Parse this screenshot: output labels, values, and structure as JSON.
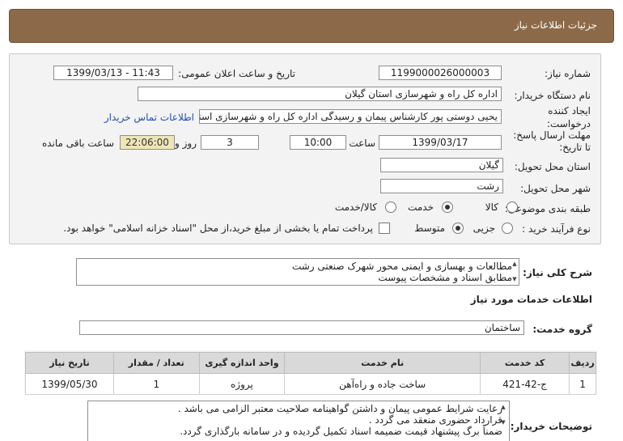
{
  "header": {
    "title": "جزئیات اطلاعات نیاز"
  },
  "form": {
    "need_number_label": "شماره نیاز:",
    "need_number": "1199000026000003",
    "announce_label": "تاریخ و ساعت اعلان عمومی:",
    "announce_value": "1399/03/13 - 11:43",
    "buyer_label": "نام دستگاه خریدار:",
    "buyer_value": "اداره کل راه و شهرسازی استان گیلان",
    "creator_label_1": "ایجاد کننده",
    "creator_label_2": "درخواست:",
    "creator_value": "یحیی دوستی پور کارشناس پیمان و رسیدگی اداره کل راه و شهرسازی استان",
    "contact_link": "اطلاعات تماس خریدار",
    "deadline_label_1": "مهلت ارسال پاسخ:",
    "deadline_label_2": "تا تاریخ:",
    "deadline_date": "1399/03/17",
    "time_label": "ساعت",
    "deadline_time": "10:00",
    "days_value": "3",
    "days_label": "روز و",
    "remaining_time": "22:06:00",
    "remaining_label": "ساعت باقی مانده",
    "province_label": "استان محل تحویل:",
    "province_value": "گیلان",
    "city_label": "شهر محل تحویل:",
    "city_value": "رشت",
    "category_label": "طبقه بندی موضوعی:",
    "category_options": [
      "کالا",
      "خدمت",
      "کالا/خدمت"
    ],
    "category_selected": "خدمت",
    "process_label": "نوع فرآیند خرید :",
    "process_options": [
      "جزیی",
      "متوسط"
    ],
    "process_selected": "متوسط",
    "payment_note": "پرداخت تمام یا بخشی از مبلغ خرید،از محل \"اسناد خزانه اسلامی\" خواهد بود."
  },
  "summary": {
    "label": "شرح کلی نیاز:",
    "lines": [
      "مطالعات و بهسازی و ایمنی محور شهرک صنعتی رشت",
      "مطابق اسناد و مشخصات پیوست"
    ]
  },
  "services": {
    "section_title": "اطلاعات خدمات مورد نیاز",
    "group_label": "گروه خدمت:",
    "group_value": "ساختمان",
    "table": {
      "headers": [
        "ردیف",
        "کد خدمت",
        "نام خدمت",
        "واحد اندازه گیری",
        "تعداد / مقدار",
        "تاریخ نیاز"
      ],
      "rows": [
        [
          "1",
          "ج-42-421",
          "ساخت جاده و راه‌آهن",
          "پروژه",
          "1",
          "1399/05/30"
        ]
      ]
    }
  },
  "buyer_notes": {
    "label": "توضیحات خریدار:",
    "lines": [
      "رعایت شرایط عمومی پیمان و داشتن گواهینامه صلاحیت معتبر الزامی می باشد .",
      "قرارداد حضوری منعقد می گردد .",
      "ضمناً برگ پیشنهاد قیمت ضمیمه اسناد تکمیل گردیده و در سامانه بارگذاری گردد."
    ]
  }
}
